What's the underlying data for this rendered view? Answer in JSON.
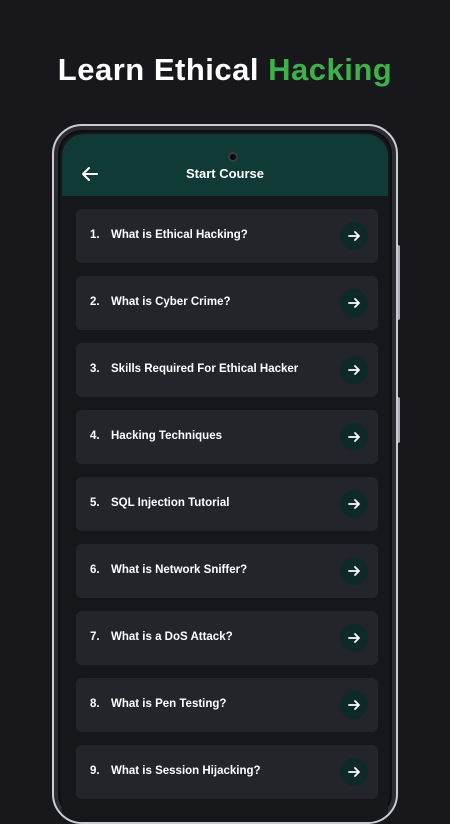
{
  "promo": {
    "title_main": "Learn Ethical ",
    "title_accent": "Hacking",
    "accent_color": "#3db24a"
  },
  "app_bar": {
    "title": "Start Course",
    "background": "#0f3a36",
    "back_icon": "arrow-left-icon"
  },
  "course": {
    "items": [
      {
        "num": "1.",
        "label": "What is Ethical Hacking?"
      },
      {
        "num": "2.",
        "label": "What is Cyber Crime?"
      },
      {
        "num": "3.",
        "label": "Skills Required For Ethical Hacker"
      },
      {
        "num": "4.",
        "label": "Hacking Techniques"
      },
      {
        "num": "5.",
        "label": "SQL Injection Tutorial"
      },
      {
        "num": "6.",
        "label": "What is Network Sniffer?"
      },
      {
        "num": "7.",
        "label": "What is a DoS Attack?"
      },
      {
        "num": "8.",
        "label": "What is Pen Testing?"
      },
      {
        "num": "9.",
        "label": "What is Session Hijacking?"
      }
    ],
    "go_icon": "arrow-right-icon"
  }
}
